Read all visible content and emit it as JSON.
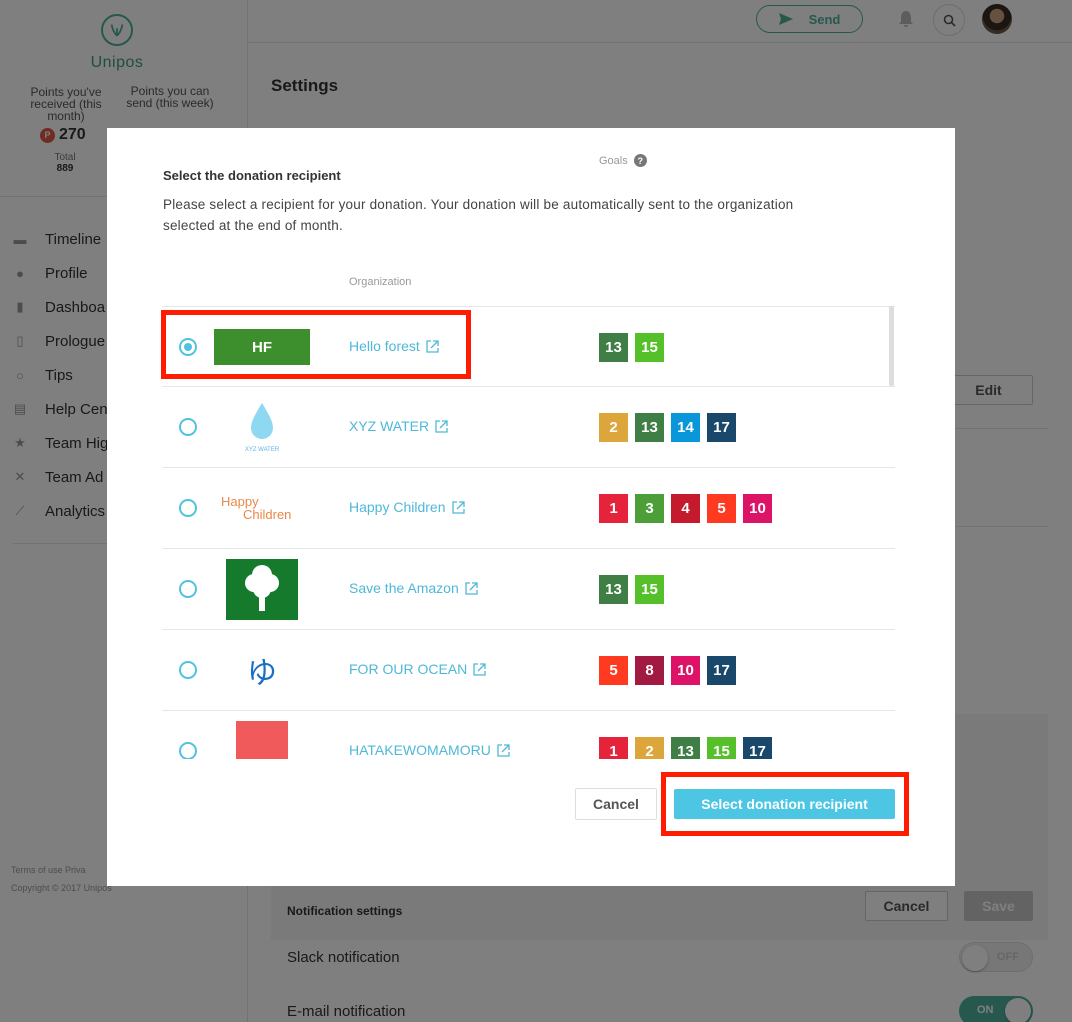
{
  "sidebar": {
    "brand": "Unipos",
    "points_received_label": "Points you've received (this month)",
    "points_send_label": "Points you can send (this week)",
    "points_badge": "P",
    "points_value": "270",
    "total_label": "Total",
    "total_value": "889",
    "nav": [
      {
        "label": "Timeline",
        "icon": "chat-icon"
      },
      {
        "label": "Profile",
        "icon": "person-icon"
      },
      {
        "label": "Dashboa",
        "icon": "bar-chart-icon"
      },
      {
        "label": "Prologue",
        "icon": "document-icon"
      },
      {
        "label": "Tips",
        "icon": "lightbulb-icon"
      },
      {
        "label": "Help Cen",
        "icon": "book-icon"
      },
      {
        "label": "Team Hig",
        "icon": "star-icon"
      },
      {
        "label": "Team Ad",
        "icon": "tools-icon"
      },
      {
        "label": "Analytics",
        "icon": "line-chart-icon"
      }
    ],
    "footer_links": "Terms of use   Priva",
    "copyright": "Copyright © 2017 Unipos"
  },
  "topbar": {
    "send_label": "Send"
  },
  "main": {
    "title": "Settings",
    "edit_label": "Edit",
    "notification_title": "Notification settings",
    "cancel_label": "Cancel",
    "save_label": "Save",
    "slack_label": "Slack notification",
    "slack_state": "OFF",
    "email_label": "E-mail notification",
    "email_state": "ON"
  },
  "modal": {
    "title": "Select the donation recipient",
    "description": "Please select a recipient for your donation. Your donation will be automatically sent to the organization selected at the end of month.",
    "col_org": "Organization",
    "col_goals": "Goals",
    "help_glyph": "?",
    "rows": [
      {
        "name": "Hello forest",
        "logo_text": "HF",
        "checked": true
      },
      {
        "name": "XYZ WATER",
        "logo_text": "XYZ WATER",
        "checked": false
      },
      {
        "name": "Happy Children",
        "logo_text_1": "Happy",
        "logo_text_2": "Children",
        "checked": false
      },
      {
        "name": "Save the Amazon",
        "checked": false
      },
      {
        "name": "FOR OUR OCEAN",
        "logo_text": "ゆ",
        "checked": false
      },
      {
        "name": "HATAKEWOMAMORU",
        "checked": false
      }
    ],
    "goals": [
      [
        "13",
        "15"
      ],
      [
        "2",
        "13",
        "14",
        "17"
      ],
      [
        "1",
        "3",
        "4",
        "5",
        "10"
      ],
      [
        "13",
        "15"
      ],
      [
        "5",
        "8",
        "10",
        "17"
      ],
      [
        "1",
        "2",
        "13",
        "15",
        "17"
      ]
    ],
    "goal_colors": {
      "1": "#e5243b",
      "2": "#dda63a",
      "3": "#4c9f38",
      "4": "#c5192d",
      "5": "#ff3a21",
      "8": "#a21942",
      "10": "#dd1367",
      "13": "#3f7e44",
      "14": "#0a97d9",
      "15": "#56c02b",
      "17": "#19486a"
    },
    "cancel_label": "Cancel",
    "confirm_label": "Select donation recipient"
  },
  "colors": {
    "accent": "#4cc6e3",
    "brand_green": "#4cb19a",
    "highlight": "#ff1c00"
  }
}
